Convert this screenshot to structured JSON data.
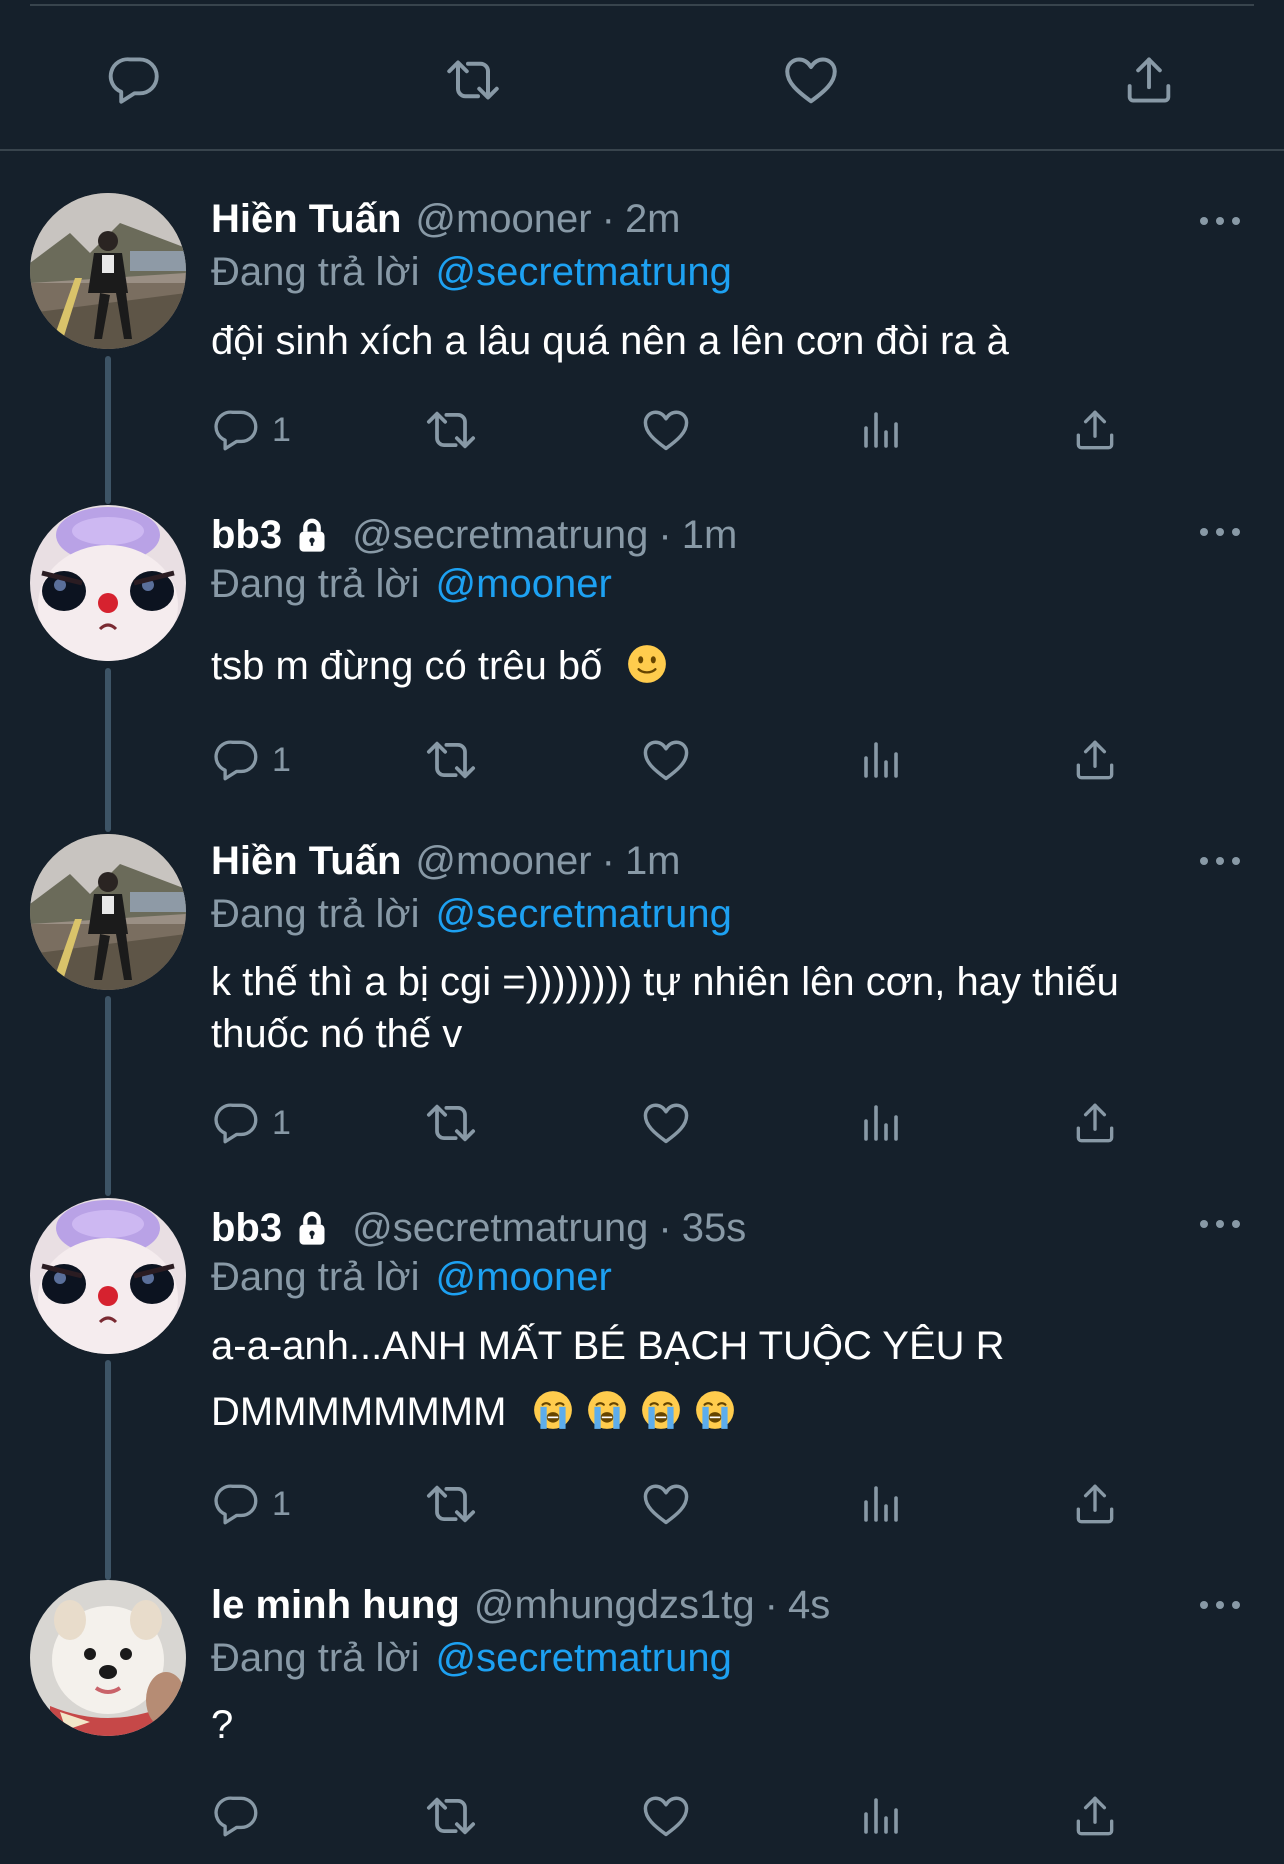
{
  "top_actions": {
    "icons": [
      "reply-icon",
      "retweet-icon",
      "like-icon",
      "share-icon"
    ]
  },
  "tweets": [
    {
      "name": "Hiền Tuấn",
      "handle": "@mooner",
      "dot": "·",
      "time": "2m",
      "replying_prefix": "Đang trả lời",
      "replying_to": "@secretmatrung",
      "text": "đội sinh xích a lâu quá nên a lên cơn đòi ra à",
      "reply_count": "1",
      "avatar": "photo-person-street"
    },
    {
      "name": "bb3",
      "protected": true,
      "handle": "@secretmatrung",
      "dot": "·",
      "time": "1m",
      "replying_prefix": "Đang trả lời",
      "replying_to": "@mooner",
      "text": "tsb m đừng có trêu bố",
      "emoji": [
        "slightly-smiling-face"
      ],
      "reply_count": "1",
      "avatar": "cartoon-character-face"
    },
    {
      "name": "Hiền Tuấn",
      "handle": "@mooner",
      "dot": "·",
      "time": "1m",
      "replying_prefix": "Đang trả lời",
      "replying_to": "@secretmatrung",
      "text_line1": "k thế thì a bị cgi =)))))))) tự nhiên lên cơn, hay thiếu",
      "text_line2": "thuốc nó thế v",
      "reply_count": "1",
      "avatar": "photo-person-street"
    },
    {
      "name": "bb3",
      "protected": true,
      "handle": "@secretmatrung",
      "dot": "·",
      "time": "35s",
      "replying_prefix": "Đang trả lời",
      "replying_to": "@mooner",
      "text_line1": "a-a-anh...ANH MẤT BÉ BẠCH TUỘC YÊU R",
      "text_line2": "DMMMMMMMM",
      "emoji": [
        "loudly-crying-face",
        "loudly-crying-face",
        "loudly-crying-face",
        "loudly-crying-face"
      ],
      "reply_count": "1",
      "avatar": "cartoon-character-face"
    },
    {
      "name": "le minh hung",
      "handle": "@mhungdzs1tg",
      "dot": "·",
      "time": "4s",
      "replying_prefix": "Đang trả lời",
      "replying_to": "@secretmatrung",
      "text": "?",
      "reply_count": "",
      "avatar": "photo-pomeranian-dog"
    }
  ],
  "colors": {
    "background": "#15202b",
    "divider": "#38444d",
    "secondary_text": "#8899a6",
    "link": "#1da1f2",
    "thread_line": "#3d5466"
  }
}
